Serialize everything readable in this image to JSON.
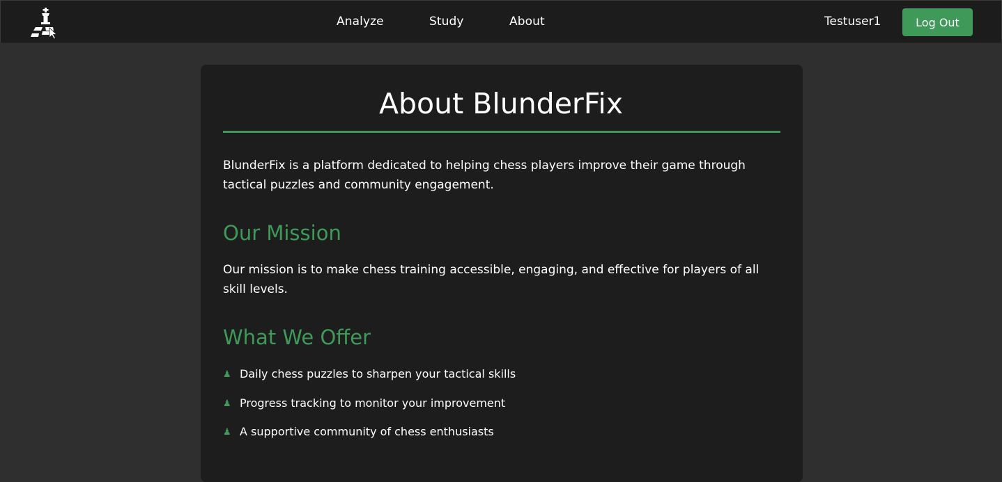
{
  "nav": {
    "logo_icon": "chess-king-logo-icon",
    "links": [
      {
        "label": "Analyze"
      },
      {
        "label": "Study"
      },
      {
        "label": "About"
      }
    ],
    "username": "Testuser1",
    "logout_label": "Log Out"
  },
  "colors": {
    "accent": "#3f9a5a",
    "page_bg": "#2f2f2f",
    "card_bg": "#1d1d1d",
    "navbar_bg": "#1c1c1c"
  },
  "about": {
    "title": "About BlunderFix",
    "intro": "BlunderFix is a platform dedicated to helping chess players improve their game through tactical puzzles and community engagement.",
    "mission_heading": "Our Mission",
    "mission_text": "Our mission is to make chess training accessible, engaging, and effective for players of all skill levels.",
    "offer_heading": "What We Offer",
    "offer_bullet_icon": "pawn-icon",
    "offers": [
      {
        "text": "Daily chess puzzles to sharpen your tactical skills"
      },
      {
        "text": "Progress tracking to monitor your improvement"
      },
      {
        "text": "A supportive community of chess enthusiasts"
      }
    ]
  }
}
